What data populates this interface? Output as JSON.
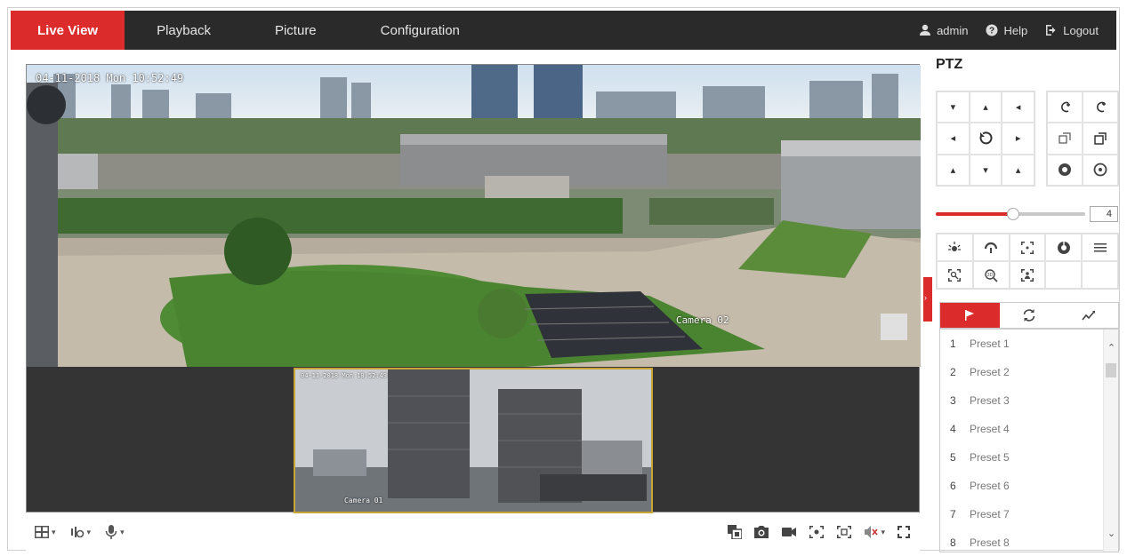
{
  "nav": {
    "tabs": [
      {
        "label": "Live View",
        "active": true
      },
      {
        "label": "Playback",
        "active": false
      },
      {
        "label": "Picture",
        "active": false
      },
      {
        "label": "Configuration",
        "active": false
      }
    ],
    "user": "admin",
    "help": "Help",
    "logout": "Logout"
  },
  "video": {
    "main_osd_time": "04-11-2018 Mon 10:52:49",
    "main_osd_camera": "Camera 02",
    "sub_osd_time": "04-11-2018 Mon 10:52:49",
    "sub_osd_camera": "Camera 01"
  },
  "ptz": {
    "title": "PTZ",
    "speed": "4",
    "speed_fraction": 0.52,
    "tabs": [
      "preset-icon",
      "patrol-icon",
      "pattern-icon"
    ],
    "presets": [
      {
        "num": "1",
        "name": "Preset 1"
      },
      {
        "num": "2",
        "name": "Preset 2"
      },
      {
        "num": "3",
        "name": "Preset 3"
      },
      {
        "num": "4",
        "name": "Preset 4"
      },
      {
        "num": "5",
        "name": "Preset 5"
      },
      {
        "num": "6",
        "name": "Preset 6"
      },
      {
        "num": "7",
        "name": "Preset 7"
      },
      {
        "num": "8",
        "name": "Preset 8"
      }
    ]
  },
  "colors": {
    "accent": "#dc2b2b",
    "nav_bg": "#2a2a2a",
    "video_bg": "#343434",
    "sub_border": "#c9a437"
  }
}
